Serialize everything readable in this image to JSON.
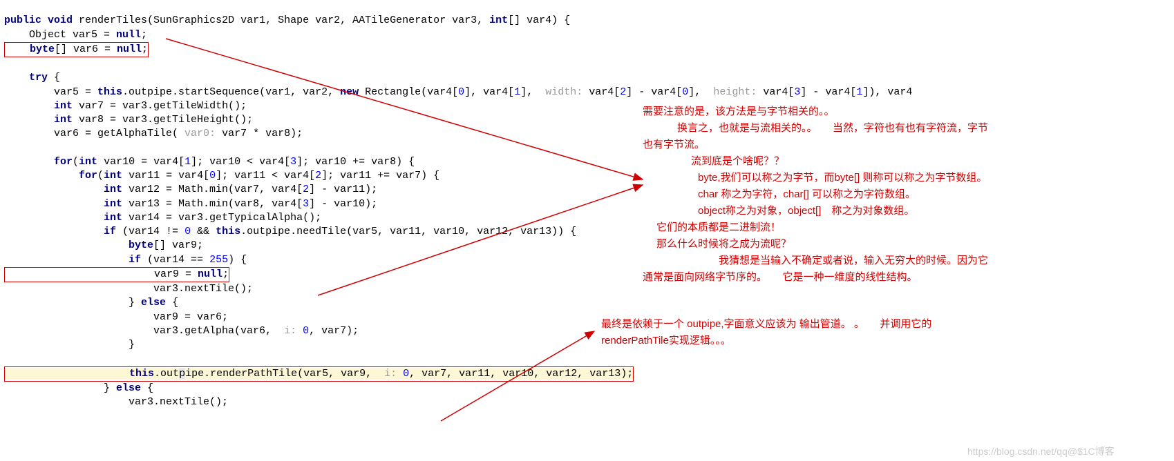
{
  "code": {
    "l01a": "public",
    "l01b": " void",
    "l01c": " renderTiles(SunGraphics2D var1, Shape var2, AATileGenerator var3, ",
    "l01d": "int",
    "l01e": "[] var4) {",
    "l02": "    Object var5 = ",
    "l02b": "null",
    "l02c": ";",
    "l03a": "    byte",
    "l03b": "[] var6 = ",
    "l03c": "null",
    "l03d": ";",
    "l04": "",
    "l05a": "    try",
    "l05b": " {",
    "l06a": "        var5 = ",
    "l06b": "this",
    "l06c": ".outpipe.startSequence(var1, var2, ",
    "l06d": "new",
    "l06e": " Rectangle(var4[",
    "l06f": "0",
    "l06g": "], var4[",
    "l06h": "1",
    "l06i": "], ",
    "l06hint1": " width: ",
    "l06j": "var4[",
    "l06k": "2",
    "l06l": "] - var4[",
    "l06m": "0",
    "l06n": "], ",
    "l06hint2": " height: ",
    "l06o": "var4[",
    "l06p": "3",
    "l06q": "] - var4[",
    "l06r": "1",
    "l06s": "]), var4",
    "l07a": "        int",
    "l07b": " var7 = var3.getTileWidth();",
    "l08a": "        int",
    "l08b": " var8 = var3.getTileHeight();",
    "l09a": "        var6 = getAlphaTile(",
    "l09hint": " var0: ",
    "l09b": "var7 * var8);",
    "l10": "",
    "l11a": "        for",
    "l11b": "(",
    "l11c": "int",
    "l11d": " var10 = var4[",
    "l11e": "1",
    "l11f": "]; var10 < var4[",
    "l11g": "3",
    "l11h": "]; var10 += var8) {",
    "l12a": "            for",
    "l12b": "(",
    "l12c": "int",
    "l12d": " var11 = var4[",
    "l12e": "0",
    "l12f": "]; var11 < var4[",
    "l12g": "2",
    "l12h": "]; var11 += var7) {",
    "l13a": "                int",
    "l13b": " var12 = Math.min(var7, var4[",
    "l13c": "2",
    "l13d": "] - var11);",
    "l14a": "                int",
    "l14b": " var13 = Math.min(var8, var4[",
    "l14c": "3",
    "l14d": "] - var10);",
    "l15a": "                int",
    "l15b": " var14 = var3.getTypicalAlpha();",
    "l16a": "                if",
    "l16b": " (var14 != ",
    "l16c": "0",
    "l16d": " && ",
    "l16e": "this",
    "l16f": ".outpipe.needTile(var5, var11, var10, var12, var13)) {",
    "l17a": "                    byte",
    "l17b": "[] var9;",
    "l18a": "                    if",
    "l18b": " (var14 == ",
    "l18c": "255",
    "l18d": ") {",
    "l19a": "                        var9 = ",
    "l19b": "null",
    "l19c": ";",
    "l20": "                        var3.nextTile();",
    "l21a": "                    } ",
    "l21b": "else",
    "l21c": " {",
    "l22": "                        var9 = var6;",
    "l23a": "                        var3.getAlpha(var6, ",
    "l23hint": " i: ",
    "l23b": "0",
    "l23c": ", var7);",
    "l24": "                    }",
    "l25": "",
    "l26a": "                    this",
    "l26b": ".out",
    "l26b2": "p",
    "l26b3": "ipe",
    "l26c": ".renderPathTile(var5, var9, ",
    "l26hint": " i: ",
    "l26d": "0",
    "l26e": ", var7, var11, var10, var12, var13);",
    "l27a": "                } ",
    "l27b": "else",
    "l27c": " {",
    "l28": "                    var3.nextTile();"
  },
  "annotation1": {
    "p1": "需要注意的是，该方法是与字节相关的。。",
    "p2": "换言之，也就是与流相关的。。　　当然，字符也有也有字符流，字节",
    "p3": "也有字节流。",
    "p4": "流到底是个啥呢？？",
    "p5": "byte,我们可以称之为字节，而byte[] 则称可以称之为字节数组。",
    "p6": "char 称之为字符，char[] 可以称之为字符数组。",
    "p7": "object称之为对象，object[]　称之为对象数组。",
    "p8": "它们的本质都是二进制流！",
    "p9": "那么什么时候将之成为流呢？",
    "p10": "我猜想是当输入不确定或者说，输入无穷大的时候。因为它",
    "p11": "通常是面向网络字节序的。　　它是一种一维度的线性结构。"
  },
  "annotation2": {
    "p1": "最终是依赖于一个 outpipe,字面意义应该为 输出管道。 。　　并调用它的",
    "p2": "renderPathTile实现逻辑。。。"
  },
  "watermark": "https://blog.csdn.net/qq@$1C博客"
}
